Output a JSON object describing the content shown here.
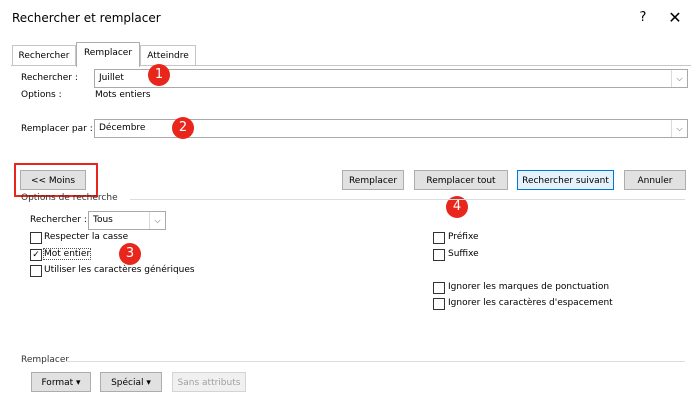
{
  "window": {
    "title": "Rechercher et remplacer",
    "help_glyph": "?",
    "close_glyph": "✕"
  },
  "tabs": [
    {
      "label": "Rechercher",
      "active": false
    },
    {
      "label": "Remplacer",
      "active": true
    },
    {
      "label": "Atteindre",
      "active": false
    }
  ],
  "search": {
    "label": "Rechercher :",
    "value": "Juillet",
    "options_label": "Options :",
    "options_value": "Mots entiers"
  },
  "replace": {
    "label": "Remplacer par :",
    "value": "Décembre"
  },
  "buttons": {
    "less": "<< Moins",
    "replace": "Remplacer",
    "replace_all": "Remplacer tout",
    "find_next": "Rechercher suivant",
    "cancel": "Annuler"
  },
  "search_options": {
    "group_title": "Options de recherche",
    "direction_label": "Rechercher :",
    "direction_value": "Tous",
    "checkboxes_left": [
      {
        "label": "Respecter la casse",
        "checked": false
      },
      {
        "label": "Mot entier",
        "checked": true
      },
      {
        "label": "Utiliser les caractères génériques",
        "checked": false
      }
    ],
    "checkboxes_right_top": [
      {
        "label": "Préfixe",
        "checked": false
      },
      {
        "label": "Suffixe",
        "checked": false
      }
    ],
    "checkboxes_right_bottom": [
      {
        "label": "Ignorer les marques de ponctuation",
        "checked": false
      },
      {
        "label": "Ignorer les caractères d'espacement",
        "checked": false
      }
    ]
  },
  "replace_group": {
    "title": "Remplacer",
    "format_button": "Format ▾",
    "special_button": "Spécial ▾",
    "no_attributes_button": "Sans attributs"
  },
  "annotations": [
    "1",
    "2",
    "3",
    "4"
  ],
  "colors": {
    "annotation_red": "#e8261c",
    "focus_blue": "#0078d7"
  }
}
